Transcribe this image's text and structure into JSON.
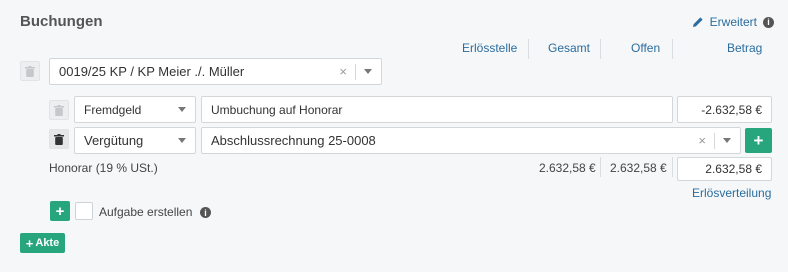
{
  "header": {
    "title": "Buchungen",
    "advanced_label": "Erweitert",
    "advanced_icon": "pencil-icon",
    "info_icon": "info-icon"
  },
  "columns": [
    "Erlösstelle",
    "Gesamt",
    "Offen",
    "Betrag"
  ],
  "file_select": {
    "value": "0019/25 KP / KP Meier ./. Müller"
  },
  "rows": [
    {
      "type": "Fremdgeld",
      "description": "Umbuchung auf Honorar",
      "amount": "-2.632,58 €"
    },
    {
      "type": "Vergütung",
      "description": "Abschlussrechnung 25-0008"
    }
  ],
  "summary": {
    "label": "Honorar (19 % USt.)",
    "gesamt": "2.632,58 €",
    "offen": "2.632,58 €",
    "betrag": "2.632,58 €",
    "distribution_link": "Erlösverteilung"
  },
  "task": {
    "label": "Aufgabe erstellen"
  },
  "add_file_button": "Akte",
  "colors": {
    "accent_green": "#27a57d",
    "link_blue": "#2a6d9e"
  }
}
